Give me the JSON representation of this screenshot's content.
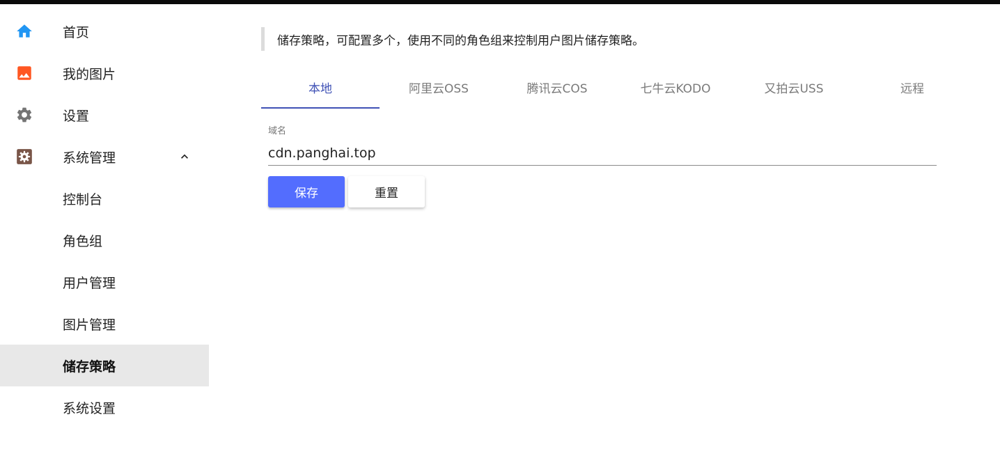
{
  "colors": {
    "accent": "#3f51b5",
    "primary_button": "#536dfe",
    "home_icon": "#2196f3",
    "images_icon": "#ff5722",
    "settings_icon": "#757575",
    "system_icon": "#795548",
    "active_bg": "#e8e8e8"
  },
  "sidebar": {
    "items": [
      {
        "label": "首页",
        "icon": "home-icon"
      },
      {
        "label": "我的图片",
        "icon": "image-icon"
      },
      {
        "label": "设置",
        "icon": "gear-icon"
      },
      {
        "label": "系统管理",
        "icon": "admin-gear-icon",
        "expanded": true
      }
    ],
    "sub_items": [
      {
        "label": "控制台"
      },
      {
        "label": "角色组"
      },
      {
        "label": "用户管理"
      },
      {
        "label": "图片管理"
      },
      {
        "label": "储存策略",
        "active": true
      },
      {
        "label": "系统设置"
      }
    ]
  },
  "main": {
    "notice": "储存策略，可配置多个，使用不同的角色组来控制用户图片储存策略。",
    "tabs": [
      {
        "label": "本地",
        "active": true
      },
      {
        "label": "阿里云OSS"
      },
      {
        "label": "腾讯云COS"
      },
      {
        "label": "七牛云KODO"
      },
      {
        "label": "又拍云USS"
      },
      {
        "label": "远程"
      }
    ],
    "domain_field": {
      "label": "域名",
      "value": "cdn.panghai.top"
    },
    "save_label": "保存",
    "reset_label": "重置"
  }
}
